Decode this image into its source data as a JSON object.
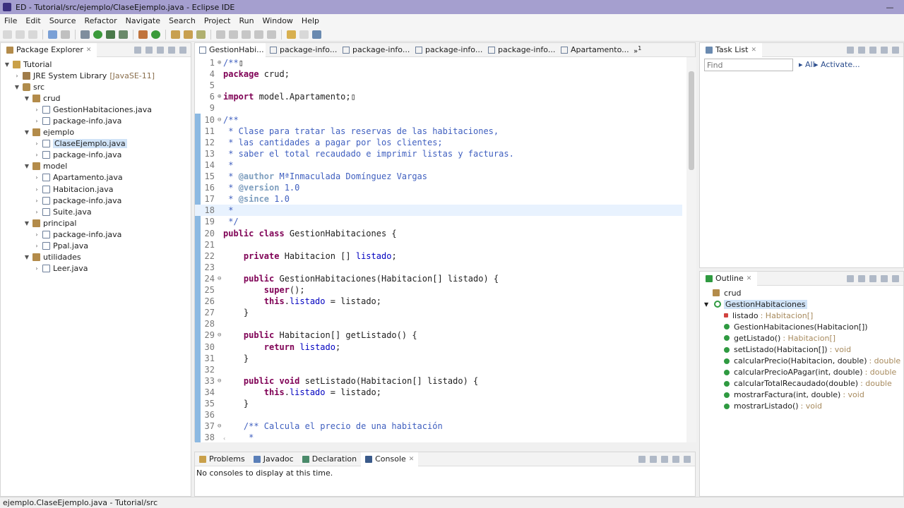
{
  "window": {
    "title": "ED - Tutorial/src/ejemplo/ClaseEjemplo.java - Eclipse IDE"
  },
  "menu": [
    "File",
    "Edit",
    "Source",
    "Refactor",
    "Navigate",
    "Search",
    "Project",
    "Run",
    "Window",
    "Help"
  ],
  "package_explorer": {
    "title": "Package Explorer",
    "tree": [
      {
        "label": "Tutorial",
        "depth": 0,
        "icon": "project-icon",
        "expanded": true
      },
      {
        "label": "JRE System Library",
        "suffix": "[JavaSE-11]",
        "depth": 1,
        "icon": "library-icon",
        "expanded": false
      },
      {
        "label": "src",
        "depth": 1,
        "icon": "source-folder-icon",
        "expanded": true
      },
      {
        "label": "crud",
        "depth": 2,
        "icon": "package-icon",
        "expanded": true
      },
      {
        "label": "GestionHabitaciones.java",
        "depth": 3,
        "icon": "java-file-icon",
        "expanded": false
      },
      {
        "label": "package-info.java",
        "depth": 3,
        "icon": "java-file-icon",
        "expanded": false
      },
      {
        "label": "ejemplo",
        "depth": 2,
        "icon": "package-icon",
        "expanded": true
      },
      {
        "label": "ClaseEjemplo.java",
        "depth": 3,
        "icon": "java-file-icon",
        "expanded": false,
        "selected": true
      },
      {
        "label": "package-info.java",
        "depth": 3,
        "icon": "java-file-icon",
        "expanded": false
      },
      {
        "label": "model",
        "depth": 2,
        "icon": "package-icon",
        "expanded": true
      },
      {
        "label": "Apartamento.java",
        "depth": 3,
        "icon": "java-file-icon",
        "expanded": false
      },
      {
        "label": "Habitacion.java",
        "depth": 3,
        "icon": "java-file-icon",
        "expanded": false
      },
      {
        "label": "package-info.java",
        "depth": 3,
        "icon": "java-file-icon",
        "expanded": false
      },
      {
        "label": "Suite.java",
        "depth": 3,
        "icon": "java-file-icon",
        "expanded": false
      },
      {
        "label": "principal",
        "depth": 2,
        "icon": "package-icon",
        "expanded": true
      },
      {
        "label": "package-info.java",
        "depth": 3,
        "icon": "java-file-icon",
        "expanded": false
      },
      {
        "label": "Ppal.java",
        "depth": 3,
        "icon": "java-file-icon",
        "expanded": false
      },
      {
        "label": "utilidades",
        "depth": 2,
        "icon": "package-icon",
        "expanded": true
      },
      {
        "label": "Leer.java",
        "depth": 3,
        "icon": "java-file-icon",
        "expanded": false
      }
    ]
  },
  "editor": {
    "tabs": [
      {
        "label": "GestionHabi...",
        "active": true
      },
      {
        "label": "package-info..."
      },
      {
        "label": "package-info..."
      },
      {
        "label": "package-info..."
      },
      {
        "label": "package-info..."
      },
      {
        "label": "Apartamento..."
      }
    ],
    "overflow_count": "1",
    "lines": [
      {
        "n": "1",
        "fold": "⊕",
        "segs": [
          [
            "cm",
            "/**"
          ],
          [
            "",
            "▯"
          ]
        ]
      },
      {
        "n": "4",
        "segs": [
          [
            "kw",
            "package"
          ],
          [
            "",
            " crud;"
          ]
        ]
      },
      {
        "n": "5",
        "segs": []
      },
      {
        "n": "6",
        "fold": "⊕",
        "segs": [
          [
            "kw",
            "import"
          ],
          [
            "",
            " model.Apartamento;▯"
          ]
        ]
      },
      {
        "n": "9",
        "segs": []
      },
      {
        "n": "10",
        "fold": "⊖",
        "segs": [
          [
            "cm",
            "/**"
          ]
        ]
      },
      {
        "n": "11",
        "segs": [
          [
            "cm",
            " * Clase para tratar las reservas de las habitaciones,"
          ]
        ]
      },
      {
        "n": "12",
        "segs": [
          [
            "cm",
            " * las cantidades a pagar por los clientes;"
          ]
        ]
      },
      {
        "n": "13",
        "segs": [
          [
            "cm",
            " * saber el total recaudado e imprimir listas y facturas."
          ]
        ]
      },
      {
        "n": "14",
        "segs": [
          [
            "cm",
            " *"
          ]
        ]
      },
      {
        "n": "15",
        "segs": [
          [
            "cm",
            " * "
          ],
          [
            "tag",
            "@author"
          ],
          [
            "cm",
            " MªInmaculada Domínguez Vargas"
          ]
        ]
      },
      {
        "n": "16",
        "segs": [
          [
            "cm",
            " * "
          ],
          [
            "tag",
            "@version"
          ],
          [
            "cm",
            " 1.0"
          ]
        ]
      },
      {
        "n": "17",
        "segs": [
          [
            "cm",
            " * "
          ],
          [
            "tag",
            "@since"
          ],
          [
            "cm",
            " 1.0"
          ]
        ]
      },
      {
        "n": "18",
        "hl": true,
        "segs": [
          [
            "cm",
            " *"
          ]
        ]
      },
      {
        "n": "19",
        "segs": [
          [
            "cm",
            " */"
          ]
        ]
      },
      {
        "n": "20",
        "segs": [
          [
            "kw",
            "public class"
          ],
          [
            "",
            " GestionHabitaciones {"
          ]
        ]
      },
      {
        "n": "21",
        "segs": []
      },
      {
        "n": "22",
        "segs": [
          [
            "",
            "    "
          ],
          [
            "kw",
            "private"
          ],
          [
            "",
            " Habitacion [] "
          ],
          [
            "fld",
            "listado"
          ],
          [
            "",
            ";"
          ]
        ]
      },
      {
        "n": "23",
        "segs": []
      },
      {
        "n": "24",
        "fold": "⊖",
        "segs": [
          [
            "",
            "    "
          ],
          [
            "kw",
            "public"
          ],
          [
            "",
            " GestionHabitaciones(Habitacion[] listado) {"
          ]
        ]
      },
      {
        "n": "25",
        "segs": [
          [
            "",
            "        "
          ],
          [
            "kw",
            "super"
          ],
          [
            "",
            "();"
          ]
        ]
      },
      {
        "n": "26",
        "segs": [
          [
            "",
            "        "
          ],
          [
            "kw",
            "this"
          ],
          [
            "",
            "."
          ],
          [
            "fld",
            "listado"
          ],
          [
            "",
            " = listado;"
          ]
        ]
      },
      {
        "n": "27",
        "segs": [
          [
            "",
            "    }"
          ]
        ]
      },
      {
        "n": "28",
        "segs": []
      },
      {
        "n": "29",
        "fold": "⊖",
        "segs": [
          [
            "",
            "    "
          ],
          [
            "kw",
            "public"
          ],
          [
            "",
            " Habitacion[] getListado() {"
          ]
        ]
      },
      {
        "n": "30",
        "segs": [
          [
            "",
            "        "
          ],
          [
            "kw",
            "return"
          ],
          [
            "",
            " "
          ],
          [
            "fld",
            "listado"
          ],
          [
            "",
            ";"
          ]
        ]
      },
      {
        "n": "31",
        "segs": [
          [
            "",
            "    }"
          ]
        ]
      },
      {
        "n": "32",
        "segs": []
      },
      {
        "n": "33",
        "fold": "⊖",
        "segs": [
          [
            "",
            "    "
          ],
          [
            "kw",
            "public void"
          ],
          [
            "",
            " setListado(Habitacion[] listado) {"
          ]
        ]
      },
      {
        "n": "34",
        "segs": [
          [
            "",
            "        "
          ],
          [
            "kw",
            "this"
          ],
          [
            "",
            "."
          ],
          [
            "fld",
            "listado"
          ],
          [
            "",
            " = listado;"
          ]
        ]
      },
      {
        "n": "35",
        "segs": [
          [
            "",
            "    }"
          ]
        ]
      },
      {
        "n": "36",
        "segs": []
      },
      {
        "n": "37",
        "fold": "⊖",
        "segs": [
          [
            "",
            "    "
          ],
          [
            "cm",
            "/** Calcula el precio de una habitación"
          ]
        ]
      },
      {
        "n": "38",
        "segs": [
          [
            "cm",
            "     *"
          ]
        ]
      }
    ]
  },
  "bottom_panel": {
    "tabs": [
      {
        "label": "Problems"
      },
      {
        "label": "Javadoc"
      },
      {
        "label": "Declaration"
      },
      {
        "label": "Console",
        "active": true
      }
    ],
    "message": "No consoles to display at this time."
  },
  "task_list": {
    "title": "Task List",
    "find_placeholder": "Find",
    "all_label": "All",
    "activate_label": "Activate..."
  },
  "outline": {
    "title": "Outline",
    "items": [
      {
        "label": "crud",
        "kind": "package"
      },
      {
        "label": "GestionHabitaciones",
        "kind": "class",
        "selected": true
      },
      {
        "label": "listado",
        "type": ": Habitacion[]",
        "kind": "private-field"
      },
      {
        "label": "GestionHabitaciones(Habitacion[])",
        "type": "",
        "kind": "constructor"
      },
      {
        "label": "getListado()",
        "type": ": Habitacion[]",
        "kind": "method"
      },
      {
        "label": "setListado(Habitacion[])",
        "type": ": void",
        "kind": "method"
      },
      {
        "label": "calcularPrecio(Habitacion, double)",
        "type": ": double",
        "kind": "method"
      },
      {
        "label": "calcularPrecioAPagar(int, double)",
        "type": ": double",
        "kind": "method"
      },
      {
        "label": "calcularTotalRecaudado(double)",
        "type": ": double",
        "kind": "method"
      },
      {
        "label": "mostrarFactura(int, double)",
        "type": ": void",
        "kind": "method"
      },
      {
        "label": "mostrarListado()",
        "type": ": void",
        "kind": "method"
      }
    ]
  },
  "status": {
    "text": "ejemplo.ClaseEjemplo.java - Tutorial/src"
  },
  "colors": {
    "titlebar": "#a59fcf",
    "keyword": "#7f0055",
    "comment": "#3f5fbf",
    "field": "#0000c0"
  }
}
